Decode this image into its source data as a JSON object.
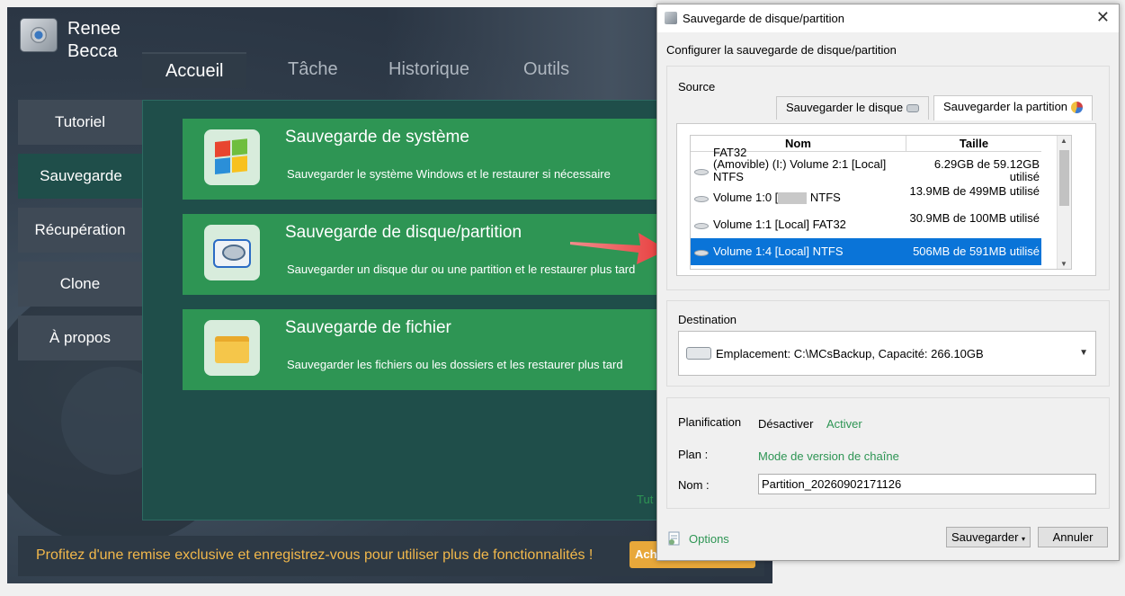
{
  "app": {
    "brand_line1": "Renee",
    "brand_line2": "Becca",
    "tabs": [
      {
        "label": "Accueil"
      },
      {
        "label": "Tâche"
      },
      {
        "label": "Historique"
      },
      {
        "label": "Outils"
      }
    ],
    "sidebar": [
      {
        "label": "Tutoriel"
      },
      {
        "label": "Sauvegarde"
      },
      {
        "label": "Récupération"
      },
      {
        "label": "Clone"
      },
      {
        "label": "À propos"
      }
    ],
    "cards": [
      {
        "title": "Sauvegarde de système",
        "desc": "Sauvegarder le système Windows et le restaurer si nécessaire",
        "icon": "windows-icon"
      },
      {
        "title": "Sauvegarde de disque/partition",
        "desc": "Sauvegarder un disque dur ou une partition et le restaurer plus tard",
        "icon": "disk-icon"
      },
      {
        "title": "Sauvegarde de fichier",
        "desc": "Sauvegarder les fichiers ou les dossiers et les restaurer plus tard",
        "icon": "folder-icon"
      }
    ],
    "tutorial_link_partial": "Tut",
    "promo_text": "Profitez d'une remise exclusive et enregistrez-vous pour utiliser plus de fonctionnalités !",
    "promo_button_partial": "Ach",
    "colors": {
      "card": "#2e9554",
      "promo": "#f2b84b",
      "selection": "#0a74d8"
    }
  },
  "dialog": {
    "title": "Sauvegarde de disque/partition",
    "heading": "Configurer la sauvegarde de disque/partition",
    "source_label": "Source",
    "tab_disk": "Sauvegarder le disque",
    "tab_partition": "Sauvegarder la partition",
    "columns": {
      "name": "Nom",
      "size": "Taille"
    },
    "rows": [
      {
        "name": "FAT32",
        "size": "",
        "partial": true
      },
      {
        "name": "(Amovible) (I:) Volume 2:1 [Local] NTFS",
        "size": "6.29GB de 59.12GB utilisé"
      },
      {
        "name": "Volume 1:0 [",
        "name_after_redaction": " NTFS",
        "size": "13.9MB de 499MB utilisé"
      },
      {
        "name": "Volume 1:1 [Local] FAT32",
        "size": "30.9MB de 100MB utilisé"
      },
      {
        "name": "Volume 1:4 [Local] NTFS",
        "size": "506MB de 591MB utilisé",
        "selected": true
      }
    ],
    "destination_label": "Destination",
    "destination_value": "Emplacement: C:\\MCsBackup, Capacité: 266.10GB",
    "planification_label": "Planification",
    "disable": "Désactiver",
    "enable": "Activer",
    "plan_label": "Plan :",
    "plan_value": "Mode de version de chaîne",
    "name_label": "Nom :",
    "name_value": "Partition_20260902171126",
    "options": "Options",
    "save_button": "Sauvegarder",
    "cancel_button": "Annuler",
    "close": "✕"
  }
}
